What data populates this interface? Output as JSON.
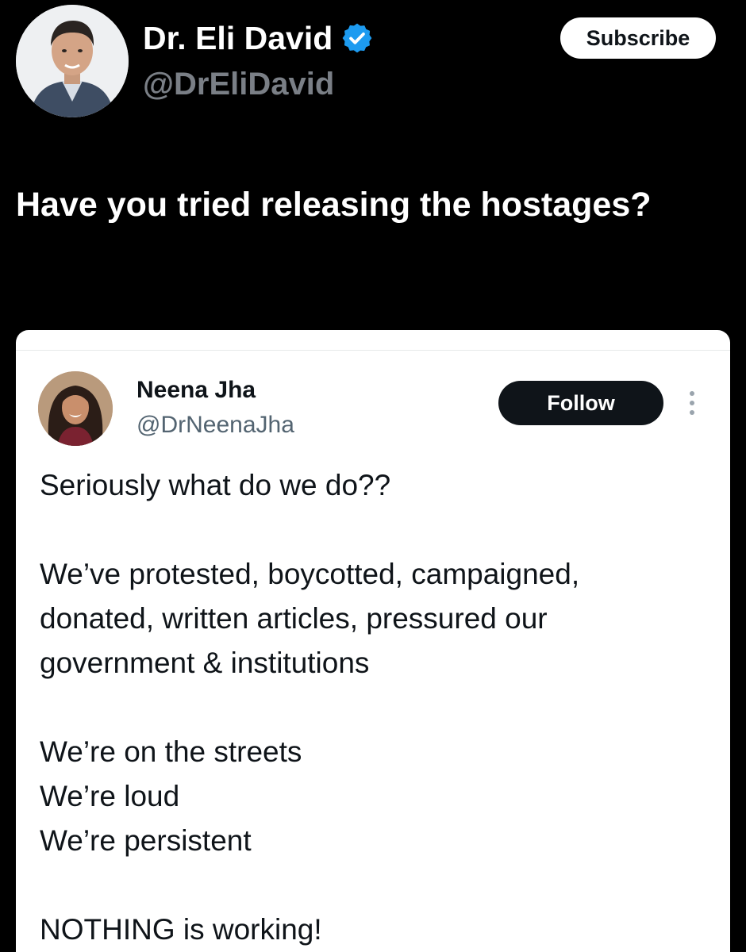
{
  "tweet": {
    "author": {
      "name": "Dr. Eli David",
      "handle": "@DrEliDavid",
      "avatar_icon": "profile-photo-man",
      "verified_icon": "verified-badge-icon",
      "verified_color": "#1d9bf0"
    },
    "subscribe_label": "Subscribe",
    "text": "Have you tried releasing the hostages?"
  },
  "quoted_tweet": {
    "author": {
      "name": "Neena Jha",
      "handle": "@DrNeenaJha",
      "avatar_icon": "profile-photo-woman"
    },
    "follow_label": "Follow",
    "more_icon": "more-options-icon",
    "lines": [
      "Seriously what do we do??",
      "",
      "We’ve protested, boycotted, campaigned,",
      "donated, written articles, pressured our",
      "government & institutions",
      "",
      "We’re on the streets",
      "We’re loud",
      "We’re persistent",
      "",
      "NOTHING is working!"
    ]
  },
  "colors": {
    "background": "#000000",
    "card_background": "#ffffff",
    "handle_gray": "#7a7f86",
    "follow_button": "#0f1419"
  }
}
